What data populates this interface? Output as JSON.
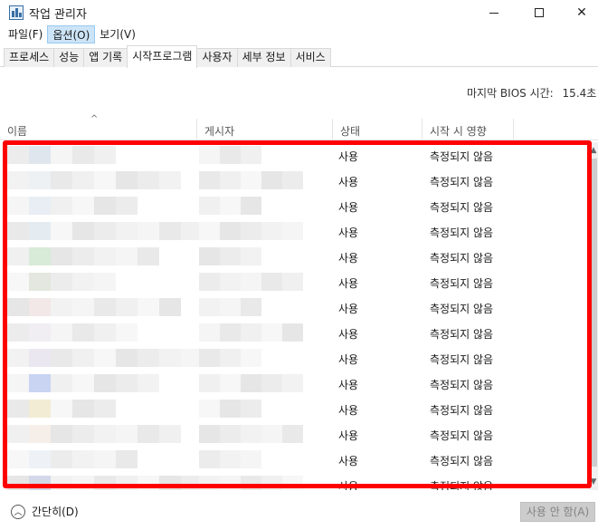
{
  "window": {
    "title": "작업 관리자",
    "icon": "task-manager-icon",
    "min_symbol": "minimize-icon",
    "max_symbol": "maximize-icon",
    "close_glyph": "✕"
  },
  "menu": [
    {
      "label": "파일(F)"
    },
    {
      "label": "옵션(O)",
      "active": true
    },
    {
      "label": "보기(V)"
    }
  ],
  "tabs": [
    {
      "label": "프로세스"
    },
    {
      "label": "성능"
    },
    {
      "label": "앱 기록"
    },
    {
      "label": "시작프로그램",
      "selected": true
    },
    {
      "label": "사용자"
    },
    {
      "label": "세부 정보"
    },
    {
      "label": "서비스"
    }
  ],
  "bios": {
    "label": "마지막 BIOS 시간:",
    "value": "15.4초"
  },
  "columns": {
    "name": "이름",
    "publisher": "게시자",
    "status": "상태",
    "impact": "시작 시 영향",
    "sort_glyph": "^"
  },
  "rows": [
    {
      "status": "사용",
      "impact": "측정되지 않음"
    },
    {
      "status": "사용",
      "impact": "측정되지 않음"
    },
    {
      "status": "사용",
      "impact": "측정되지 않음"
    },
    {
      "status": "사용",
      "impact": "측정되지 않음"
    },
    {
      "status": "사용",
      "impact": "측정되지 않음"
    },
    {
      "status": "사용",
      "impact": "측정되지 않음"
    },
    {
      "status": "사용",
      "impact": "측정되지 않음"
    },
    {
      "status": "사용",
      "impact": "측정되지 않음"
    },
    {
      "status": "사용",
      "impact": "측정되지 않음"
    },
    {
      "status": "사용",
      "impact": "측정되지 않음"
    },
    {
      "status": "사용",
      "impact": "측정되지 않음"
    },
    {
      "status": "사용",
      "impact": "측정되지 않음"
    },
    {
      "status": "사용",
      "impact": "측정되지 않음"
    },
    {
      "status": "사용",
      "impact": "측정되지 않음"
    }
  ],
  "footer": {
    "fewer_details": "간단히(D)",
    "disable_button": "사용 안 함(A)"
  },
  "colors": {
    "highlight": "#ff0000",
    "menu_active": "#cce4f7",
    "disabled_button": "#cccccc"
  }
}
